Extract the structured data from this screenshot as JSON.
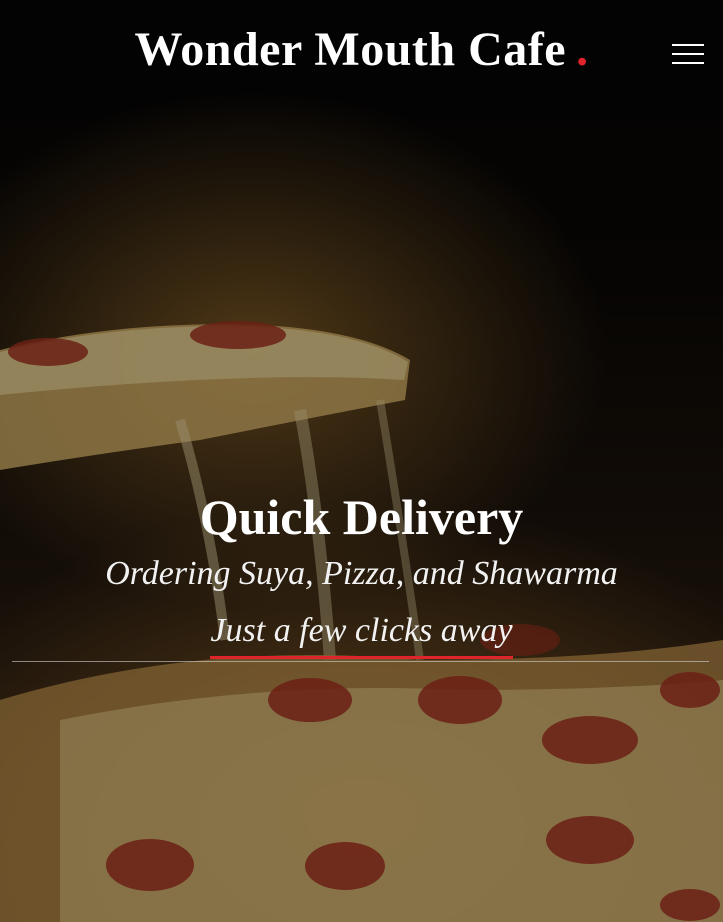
{
  "header": {
    "brand_name": "Wonder Mouth Cafe",
    "brand_dot": ".",
    "menu_icon": "hamburger-menu-icon"
  },
  "hero": {
    "background": "pizza-slice-photo",
    "title": "Quick Delivery",
    "subtitle": "Ordering Suya, Pizza, and Shawarma",
    "tagline": "Just a few clicks away"
  },
  "colors": {
    "accent": "#e0242b",
    "text": "#ffffff",
    "background": "#000000"
  }
}
